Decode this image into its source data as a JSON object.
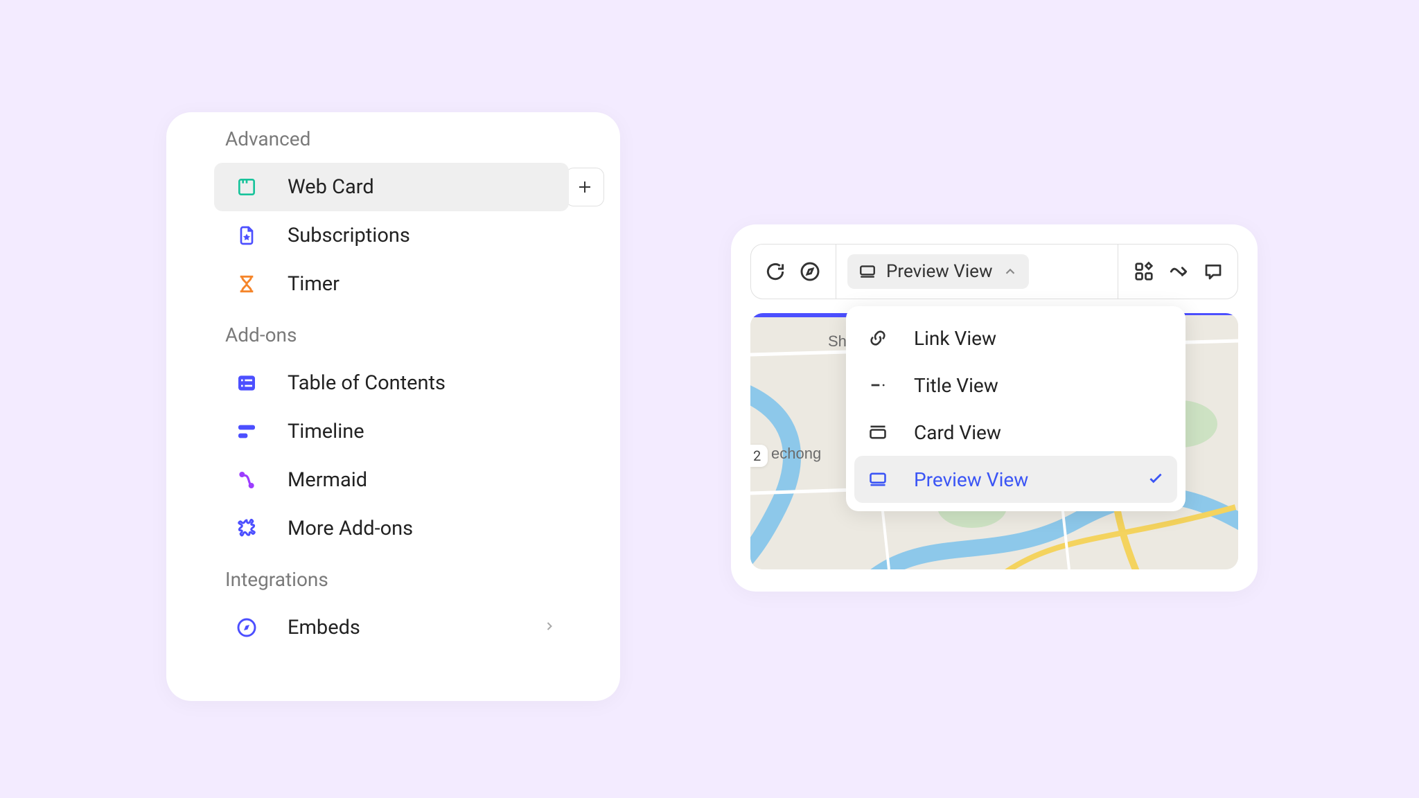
{
  "menu": {
    "sections": [
      {
        "header": "Advanced",
        "items": [
          {
            "label": "Web Card",
            "selected": true
          },
          {
            "label": "Subscriptions"
          },
          {
            "label": "Timer"
          }
        ]
      },
      {
        "header": "Add-ons",
        "items": [
          {
            "label": "Table of Contents"
          },
          {
            "label": "Timeline"
          },
          {
            "label": "Mermaid"
          },
          {
            "label": "More Add-ons"
          }
        ]
      },
      {
        "header": "Integrations",
        "items": [
          {
            "label": "Embeds",
            "chevron": true
          }
        ]
      }
    ]
  },
  "view_toolbar": {
    "selected_label": "Preview View"
  },
  "view_options": [
    {
      "label": "Link View"
    },
    {
      "label": "Title View"
    },
    {
      "label": "Card View"
    },
    {
      "label": "Preview View",
      "selected": true
    }
  ],
  "map": {
    "label_a": "Shib",
    "label_b": "echong",
    "badge": "2"
  }
}
